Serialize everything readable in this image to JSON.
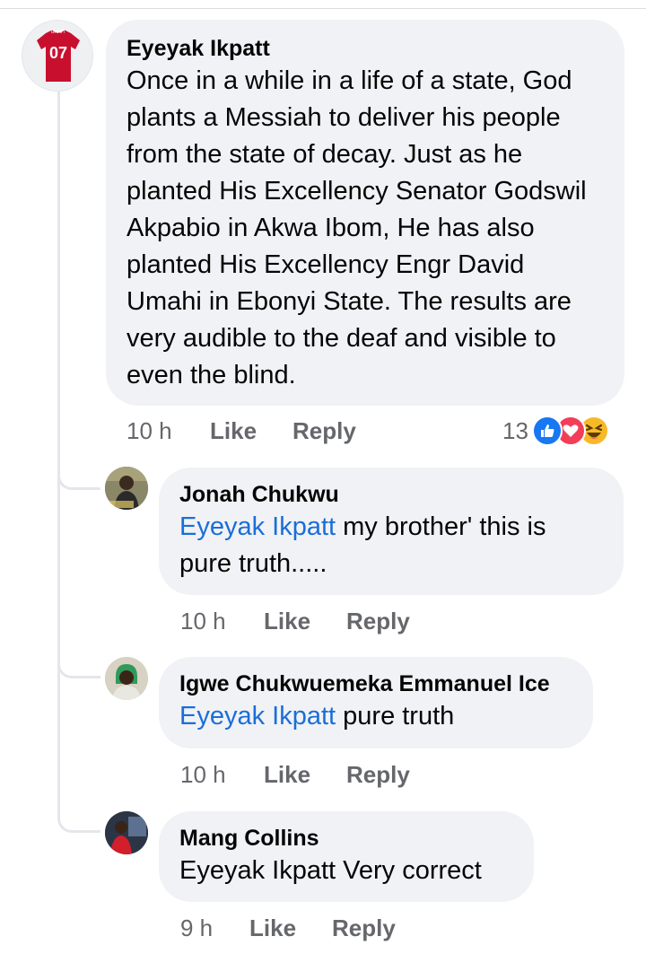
{
  "main_comment": {
    "author": "Eyeyak Ikpatt",
    "avatar_label": "07",
    "text": "Once in a while in a life of a state, God plants a Messiah to deliver his people from the state of decay. Just as he planted His Excellency Senator Godswil Akpabio in Akwa Ibom, He has also planted His Excellency Engr David Umahi in Ebonyi State. The results are very audible to the deaf and visible to even the blind.",
    "time": "10 h",
    "like_label": "Like",
    "reply_label": "Reply",
    "reaction_count": "13",
    "reaction_icons": [
      "like-icon",
      "love-icon",
      "haha-icon"
    ]
  },
  "replies": [
    {
      "author": "Jonah Chukwu",
      "mention": "Eyeyak Ikpatt",
      "text": " my brother' this is pure truth.....",
      "time": "10 h",
      "like_label": "Like",
      "reply_label": "Reply"
    },
    {
      "author": "Igwe Chukwuemeka Emmanuel Ice",
      "mention": "Eyeyak Ikpatt",
      "text": " pure truth",
      "time": "10 h",
      "like_label": "Like",
      "reply_label": "Reply"
    },
    {
      "author": "Mang Collins",
      "text": "Eyeyak Ikpatt Very correct",
      "time": "9 h",
      "like_label": "Like",
      "reply_label": "Reply"
    }
  ],
  "colors": {
    "bubble": "#f0f2f5",
    "mention": "#1a6ed8",
    "meta": "#65676b",
    "like_reaction": "#1877f2",
    "love_reaction": "#f33e58",
    "haha_reaction": "#f7b928"
  }
}
